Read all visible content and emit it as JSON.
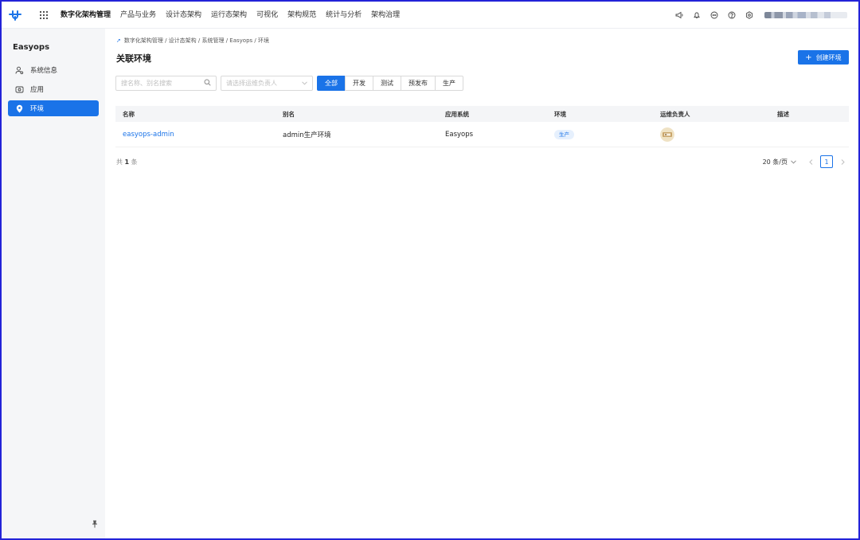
{
  "topbar": {
    "logo_icon": "easyops-logo-icon",
    "apps_icon": "apps-grid-icon",
    "nav": [
      {
        "label": "数字化架构管理",
        "active": true
      },
      {
        "label": "产品与业务"
      },
      {
        "label": "设计态架构"
      },
      {
        "label": "运行态架构"
      },
      {
        "label": "可视化"
      },
      {
        "label": "架构规范"
      },
      {
        "label": "统计与分析"
      },
      {
        "label": "架构治理"
      }
    ],
    "icons": [
      "megaphone-icon",
      "bell-icon",
      "message-icon",
      "help-icon",
      "settings-icon"
    ]
  },
  "sidebar": {
    "title": "Easyops",
    "items": [
      {
        "label": "系统信息",
        "icon": "system-info-icon"
      },
      {
        "label": "应用",
        "icon": "app-icon"
      },
      {
        "label": "环境",
        "icon": "location-icon",
        "active": true
      }
    ],
    "pin_icon": "pin-icon"
  },
  "main": {
    "breadcrumb": "数字化架构管理 / 设计态架构 / 系统管理 / Easyops / 环境",
    "title": "关联环境",
    "create_button": "创建环境",
    "search": {
      "placeholder": "搜名称、别名搜索"
    },
    "owner_select": {
      "placeholder": "请选择运维负责人"
    },
    "segments": [
      {
        "label": "全部",
        "active": true
      },
      {
        "label": "开发"
      },
      {
        "label": "测试"
      },
      {
        "label": "预发布"
      },
      {
        "label": "生产"
      }
    ],
    "table": {
      "columns": [
        "名称",
        "别名",
        "应用系统",
        "环境",
        "运维负责人",
        "描述"
      ],
      "rows": [
        {
          "name": "easyops-admin",
          "alias": "admin生产环境",
          "system": "Easyops",
          "env": "生产",
          "owner": "avatar",
          "desc": ""
        }
      ]
    },
    "total": {
      "prefix": "共",
      "count": "1",
      "suffix": "条"
    },
    "pagination": {
      "page_size": "20 条/页",
      "current": "1"
    }
  },
  "colors": {
    "accent": "#1a73e8",
    "frame": "#2323d8",
    "sidebar_bg": "#f5f6f8"
  }
}
